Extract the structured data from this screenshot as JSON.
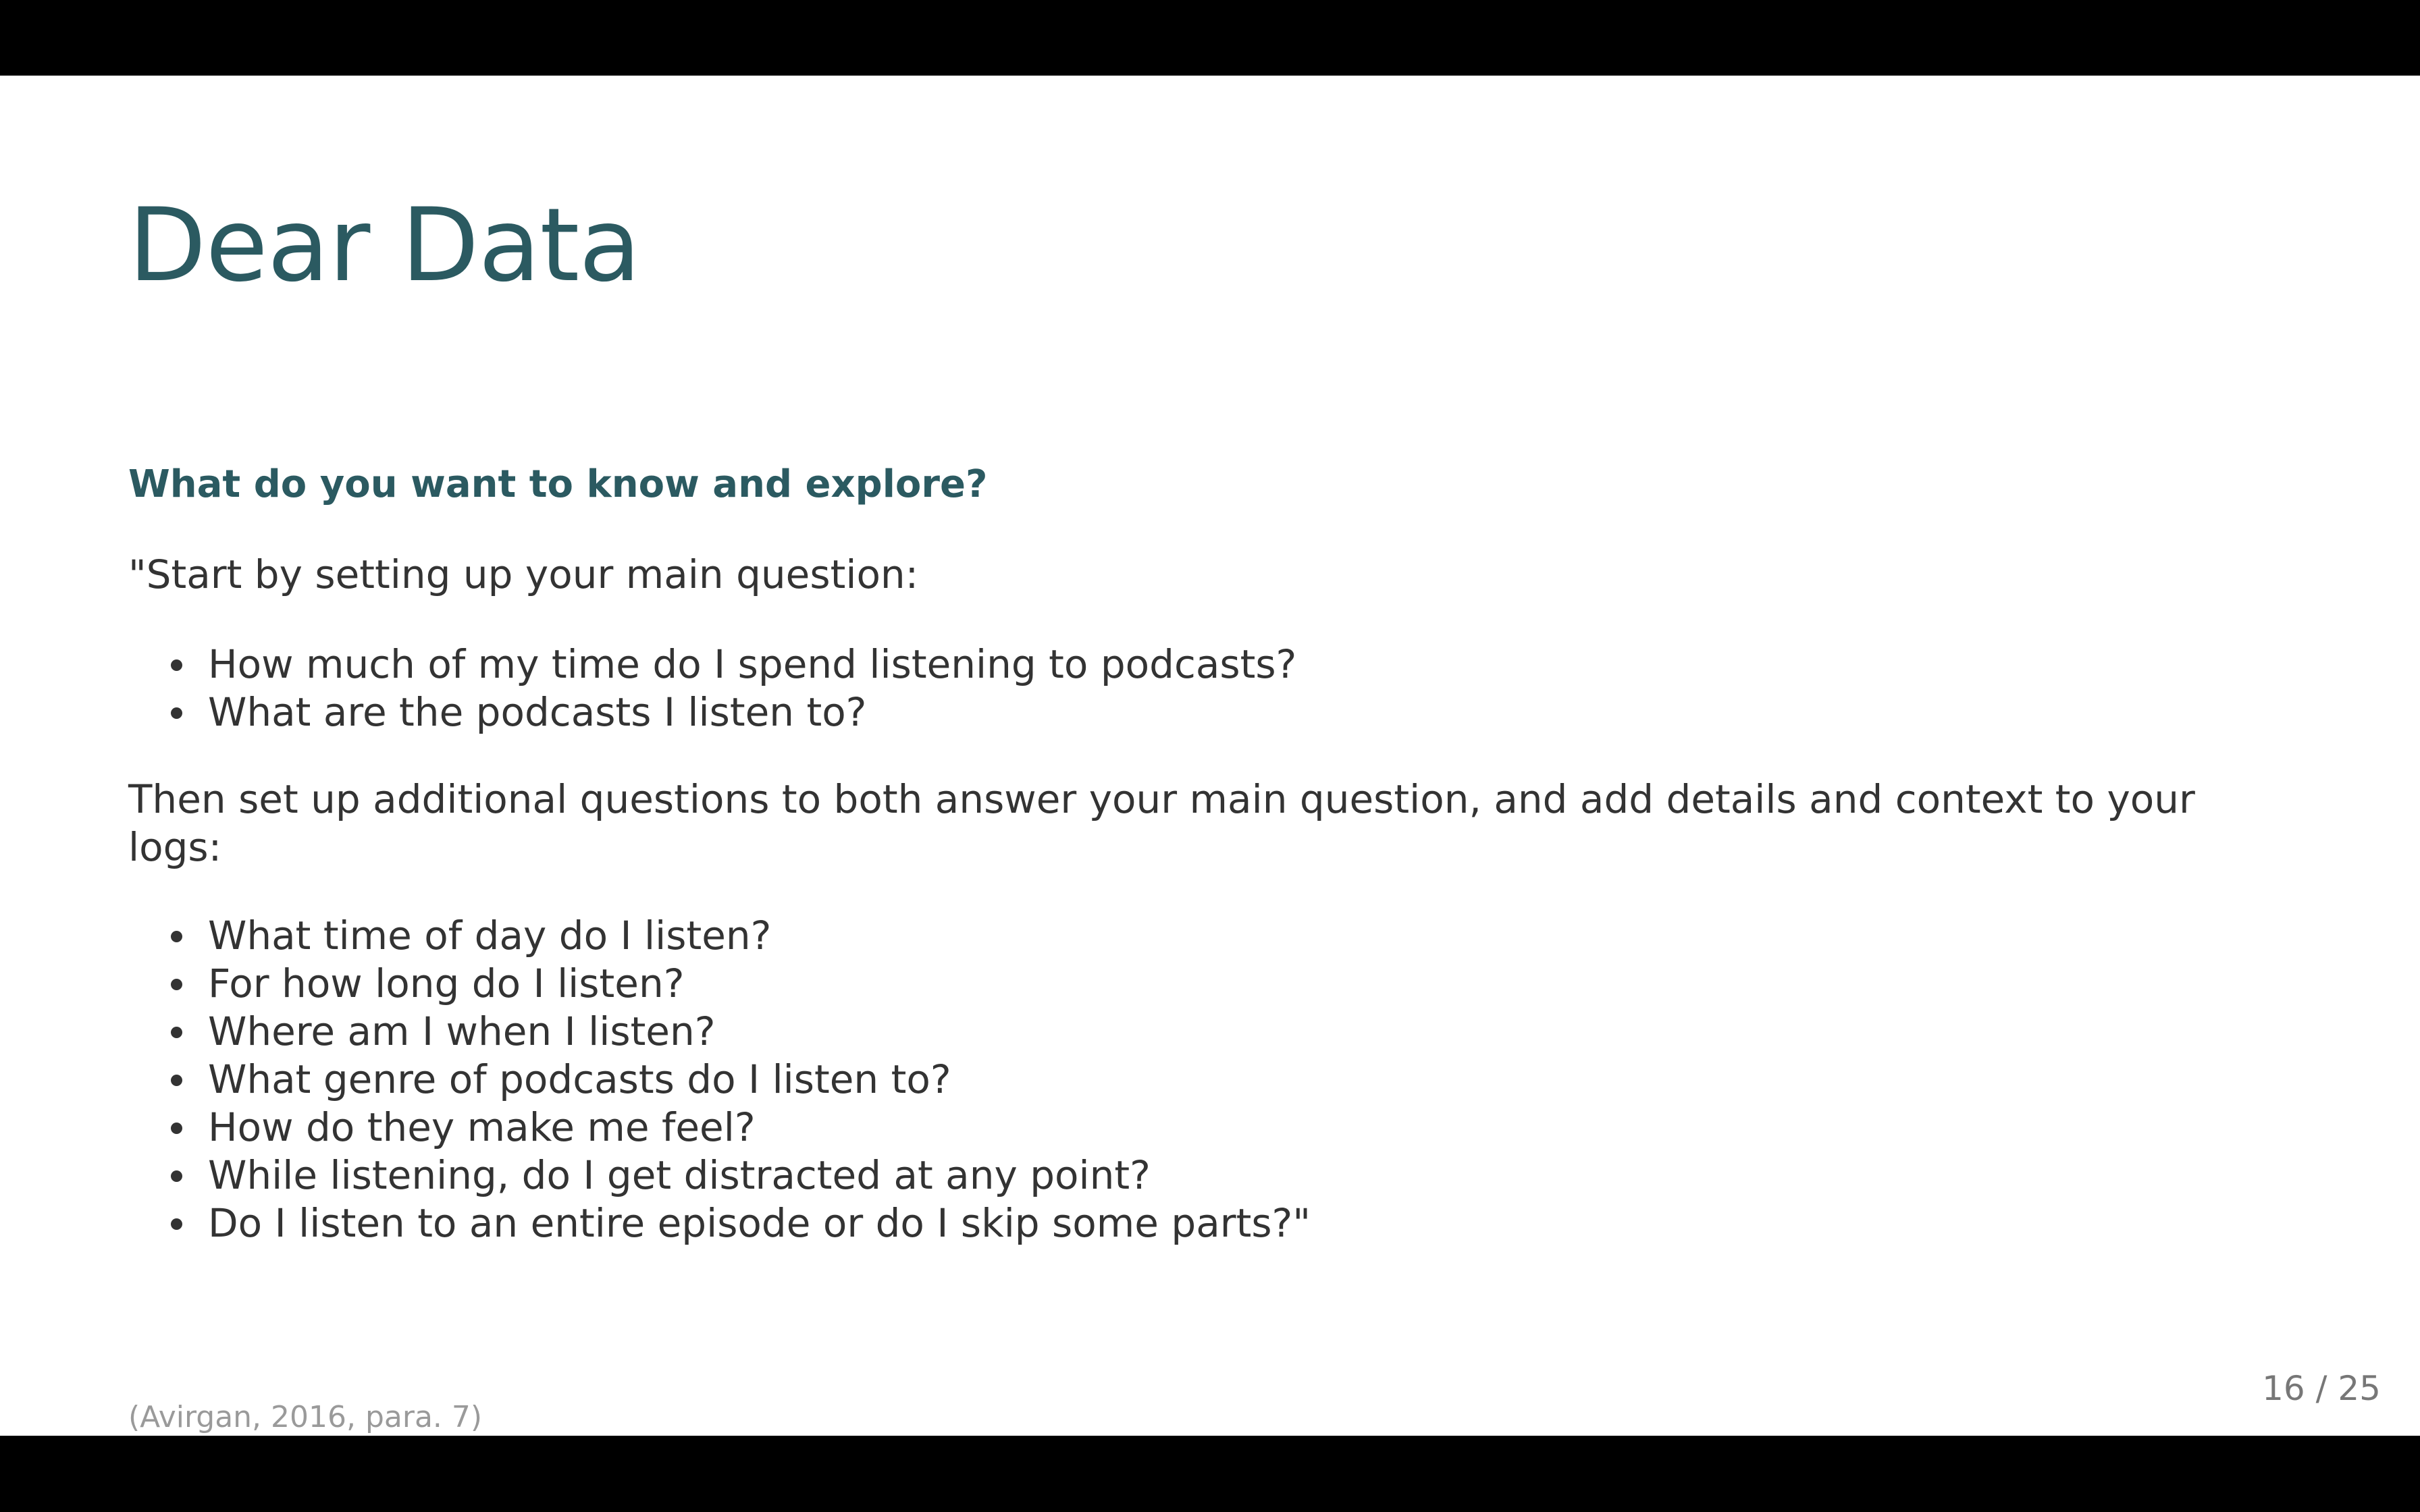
{
  "slide": {
    "title": "Dear Data",
    "subtitle": "What do you want to know and explore?",
    "intro": "\"Start by setting up your main question:",
    "main_questions": [
      "How much of my time do I spend listening to podcasts?",
      "What are the podcasts I listen to?"
    ],
    "context": "Then set up additional questions to both answer your main question, and add details and context to your logs:",
    "additional_questions": [
      "What time of day do I listen?",
      "For how long do I listen?",
      "Where am I when I listen?",
      "What genre of podcasts do I listen to?",
      "How do they make me feel?",
      "While listening, do I get distracted at any point?",
      "Do I listen to an entire episode or do I skip some parts?\""
    ],
    "citation": "(Avirgan, 2016, para. 7)",
    "page_number": "16 / 25"
  },
  "colors": {
    "title": "#2b5a61",
    "body_text": "#333333",
    "citation": "#9a9a9a",
    "letterbox": "#000000",
    "background": "#ffffff"
  }
}
